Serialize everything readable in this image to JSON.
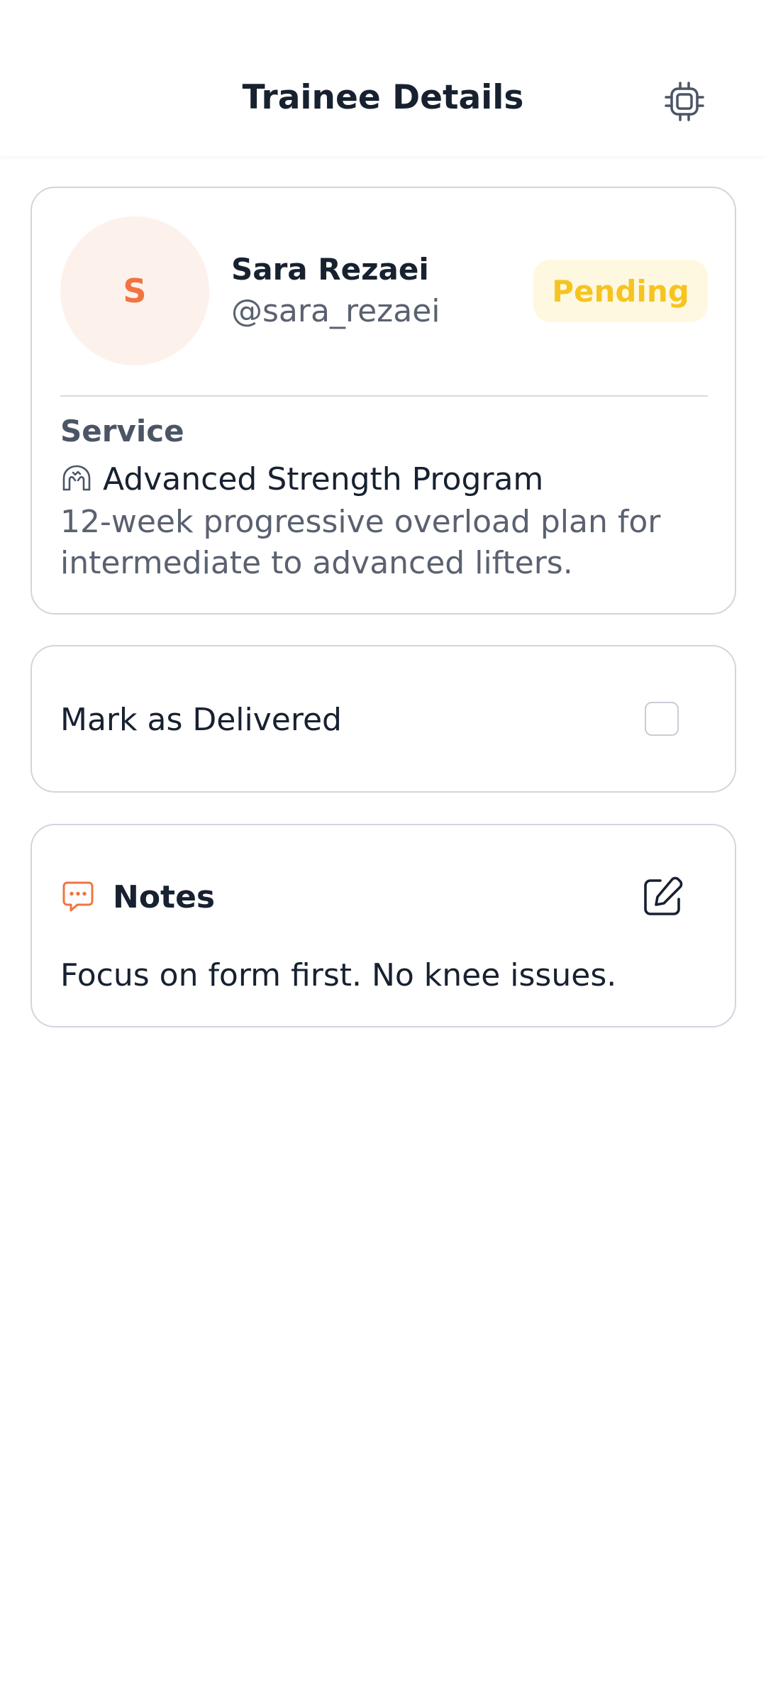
{
  "header": {
    "title": "Trainee Details",
    "action_icon": "chip-icon"
  },
  "trainee": {
    "initial": "S",
    "name": "Sara Rezaei",
    "handle": "@sara_rezaei",
    "status": "Pending"
  },
  "service": {
    "label": "Service",
    "icon": "muscle-icon",
    "name": "Advanced Strength Program",
    "description": "12-week progressive overload plan for intermediate to advanced lifters."
  },
  "delivery": {
    "label": "Mark as Delivered",
    "checked": false
  },
  "notes": {
    "icon": "chat-bubble-icon",
    "title": "Notes",
    "edit_icon": "edit-icon",
    "text": "Focus on form first. No knee issues."
  },
  "colors": {
    "accent": "#f07443",
    "pending": "#f6c421",
    "pending_bg": "#fff8e0",
    "border": "#d2d5de"
  }
}
